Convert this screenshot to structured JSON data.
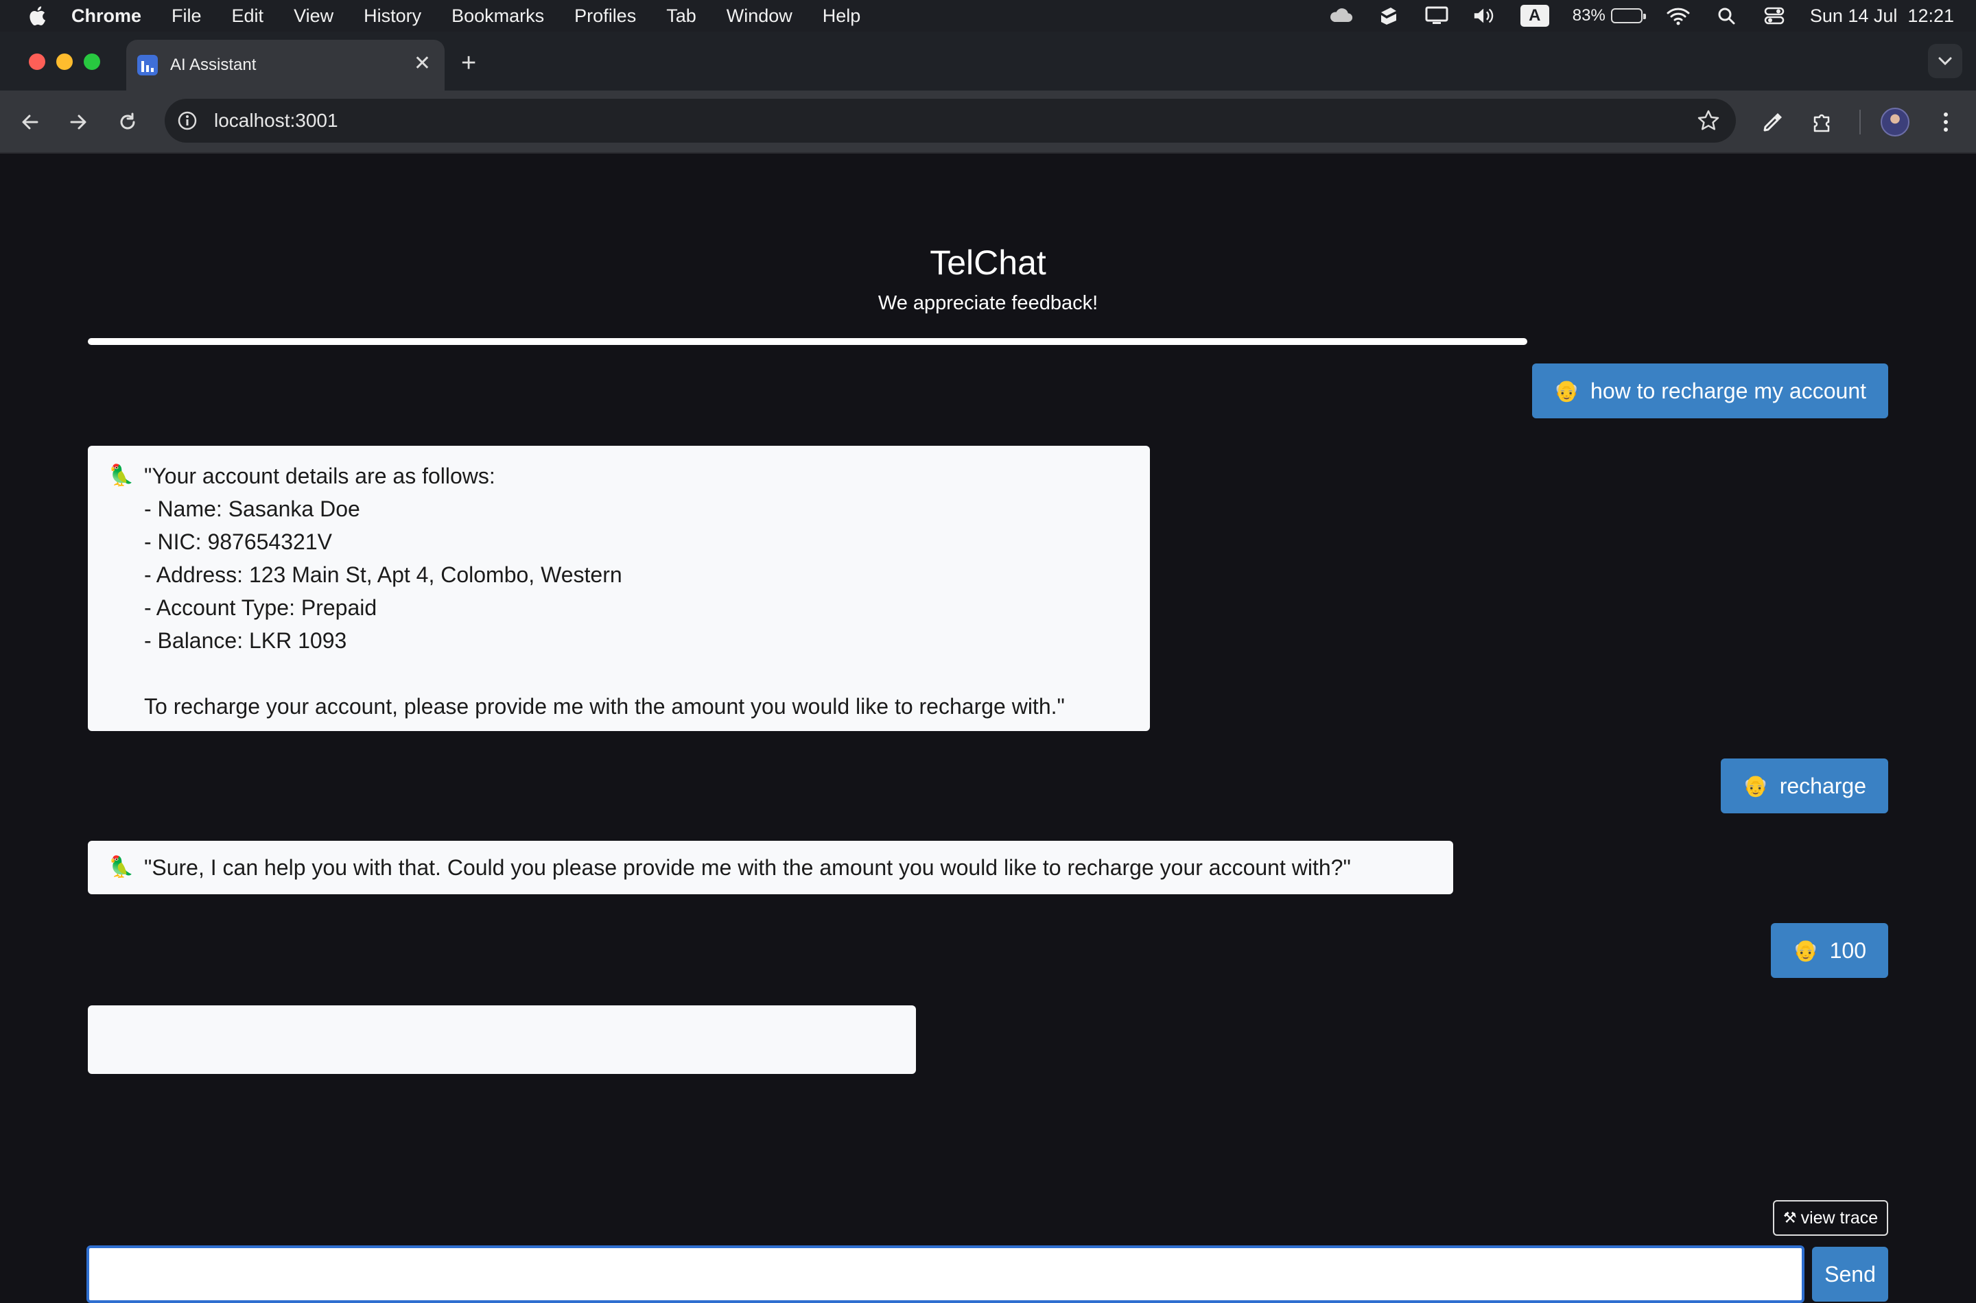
{
  "menubar": {
    "items": [
      "Chrome",
      "File",
      "Edit",
      "View",
      "History",
      "Bookmarks",
      "Profiles",
      "Tab",
      "Window",
      "Help"
    ],
    "keyboard_input": "A",
    "battery_percent": "83%",
    "battery_level": 0.83,
    "datetime": "Sun 14 Jul  12:21"
  },
  "browser": {
    "tab_title": "AI Assistant",
    "tab_close": "✕",
    "new_tab": "+",
    "url": "localhost:3001"
  },
  "app": {
    "title": "TelChat",
    "subtitle": "We appreciate feedback!",
    "messages": [
      {
        "role": "user",
        "emoji": "👴",
        "text": "how to recharge my account"
      },
      {
        "role": "bot",
        "emoji": "🦜",
        "text": "\"Your account details are as follows:\n- Name: Sasanka Doe\n- NIC: 987654321V\n- Address: 123 Main St, Apt 4, Colombo, Western\n- Account Type: Prepaid\n- Balance: LKR 1093\n\nTo recharge your account, please provide me with the amount you would like to recharge with.\""
      },
      {
        "role": "user",
        "emoji": "👴",
        "text": "recharge"
      },
      {
        "role": "bot",
        "emoji": "🦜",
        "text": "\"Sure, I can help you with that. Could you please provide me with the amount you would like to recharge your account with?\""
      },
      {
        "role": "user",
        "emoji": "👴",
        "text": "100"
      }
    ],
    "view_trace_label": "view trace",
    "input_value": "",
    "send_label": "Send"
  },
  "colors": {
    "accent": "#3a81c4",
    "page_bg": "#121217",
    "bot_bubble": "#f8f9fb"
  }
}
